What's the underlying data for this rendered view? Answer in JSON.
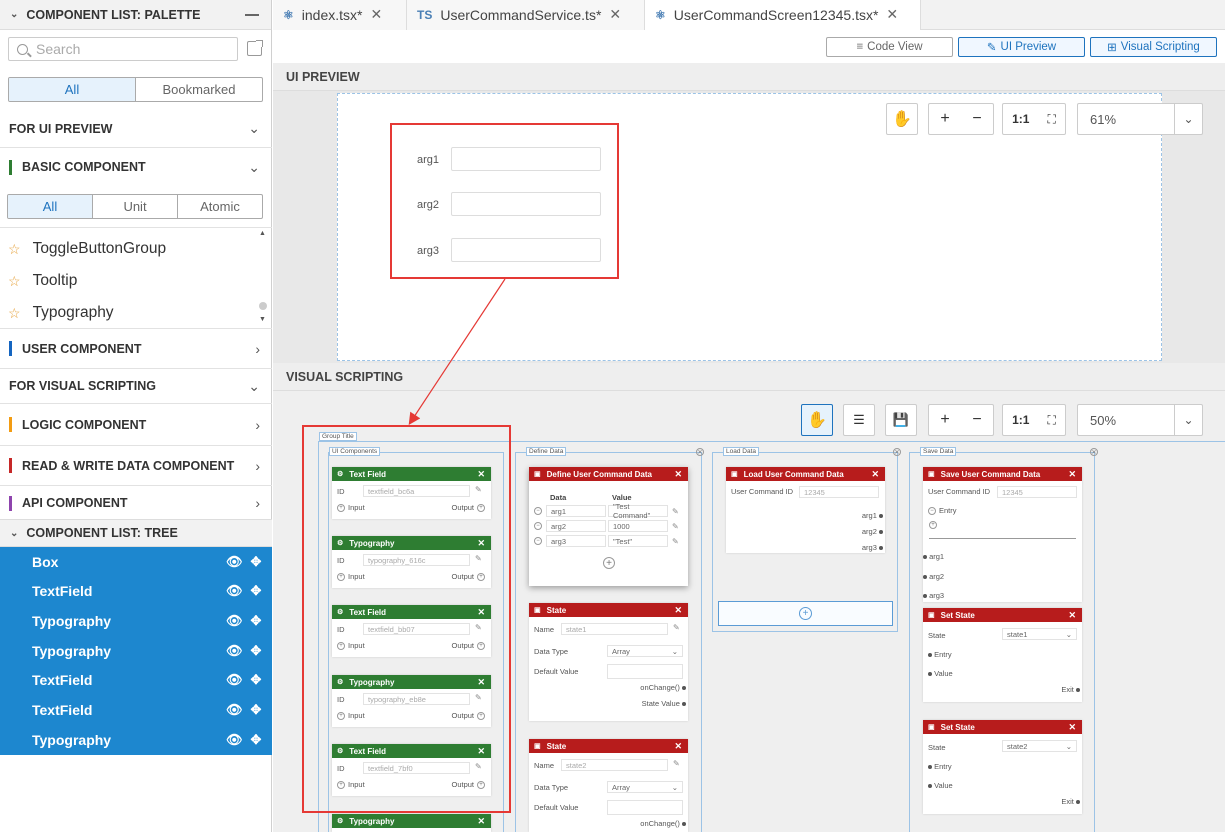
{
  "palette": {
    "title": "COMPONENT LIST: PALETTE",
    "search_placeholder": "Search",
    "filter_tabs": [
      "All",
      "Bookmarked"
    ],
    "for_ui_preview": "FOR UI PREVIEW",
    "basic_component": "BASIC COMPONENT",
    "basic_tabs": [
      "All",
      "Unit",
      "Atomic"
    ],
    "favorites": [
      "ToggleButtonGroup",
      "Tooltip",
      "Typography"
    ],
    "user_component": "USER COMPONENT",
    "for_visual_scripting": "FOR VISUAL SCRIPTING",
    "logic_component": "LOGIC COMPONENT",
    "rw_component": "READ & WRITE DATA COMPONENT",
    "api_component": "API COMPONENT",
    "colors": {
      "basic": "#2e7d32",
      "user": "#1565c0",
      "logic": "#f39c12",
      "rw": "#c62828",
      "api": "#8e44ad"
    }
  },
  "tree": {
    "title": "COMPONENT LIST: TREE",
    "items": [
      "Box",
      "TextField",
      "Typography",
      "Typography",
      "TextField",
      "TextField",
      "Typography"
    ]
  },
  "tabs": [
    {
      "icon": "⚛",
      "label": "index.tsx*"
    },
    {
      "icon": "TS",
      "label": "UserCommandService.ts*"
    },
    {
      "icon": "⚛",
      "label": "UserCommandScreen12345.tsx*"
    }
  ],
  "view_buttons": {
    "code": "Code View",
    "ui": "UI Preview",
    "vs": "Visual Scripting"
  },
  "ui_preview": {
    "title": "UI PREVIEW",
    "zoom": "61%",
    "one_to_one": "1:1",
    "args": [
      "arg1",
      "arg2",
      "arg3"
    ]
  },
  "visual_scripting": {
    "title": "VISUAL SCRIPTING",
    "zoom": "50%",
    "one_to_one": "1:1",
    "group_title": "Group Title",
    "ui_components_label": "UI Components",
    "define_data_label": "Define Data",
    "load_data_label": "Load Data",
    "save_data_label": "Save Data",
    "ui_nodes": [
      {
        "type": "Text Field",
        "id": "textfield_bc6a"
      },
      {
        "type": "Typography",
        "id": "typography_616c"
      },
      {
        "type": "Text Field",
        "id": "textfield_bb07"
      },
      {
        "type": "Typography",
        "id": "typography_eb8e"
      },
      {
        "type": "Text Field",
        "id": "textfield_7bf0"
      },
      {
        "type": "Typography",
        "id": ""
      }
    ],
    "node_labels": {
      "id": "ID",
      "input": "Input",
      "output": "Output",
      "name": "Name",
      "data_type": "Data Type",
      "default_value": "Default Value",
      "on_change": "onChange()",
      "state_value": "State Value",
      "user_command_id": "User Command ID",
      "entry": "Entry",
      "state": "State",
      "value": "Value",
      "exit": "Exit",
      "data": "Data"
    },
    "define": {
      "title": "Define User Command Data",
      "rows": [
        {
          "data": "arg1",
          "value": "\"Test Command\""
        },
        {
          "data": "arg2",
          "value": "1000"
        },
        {
          "data": "arg3",
          "value": "\"Test\""
        }
      ]
    },
    "states": [
      {
        "title": "State",
        "name": "state1",
        "type": "Array"
      },
      {
        "title": "State",
        "name": "state2",
        "type": "Array"
      }
    ],
    "load": {
      "title": "Load User Command Data",
      "id": "12345",
      "outputs": [
        "arg1",
        "arg2",
        "arg3"
      ]
    },
    "save": {
      "title": "Save User Command Data",
      "id": "12345",
      "inputs": [
        "arg1",
        "arg2",
        "arg3"
      ]
    },
    "set_states": [
      {
        "title": "Set State",
        "state": "state1"
      },
      {
        "title": "Set State",
        "state": "state2"
      }
    ]
  }
}
